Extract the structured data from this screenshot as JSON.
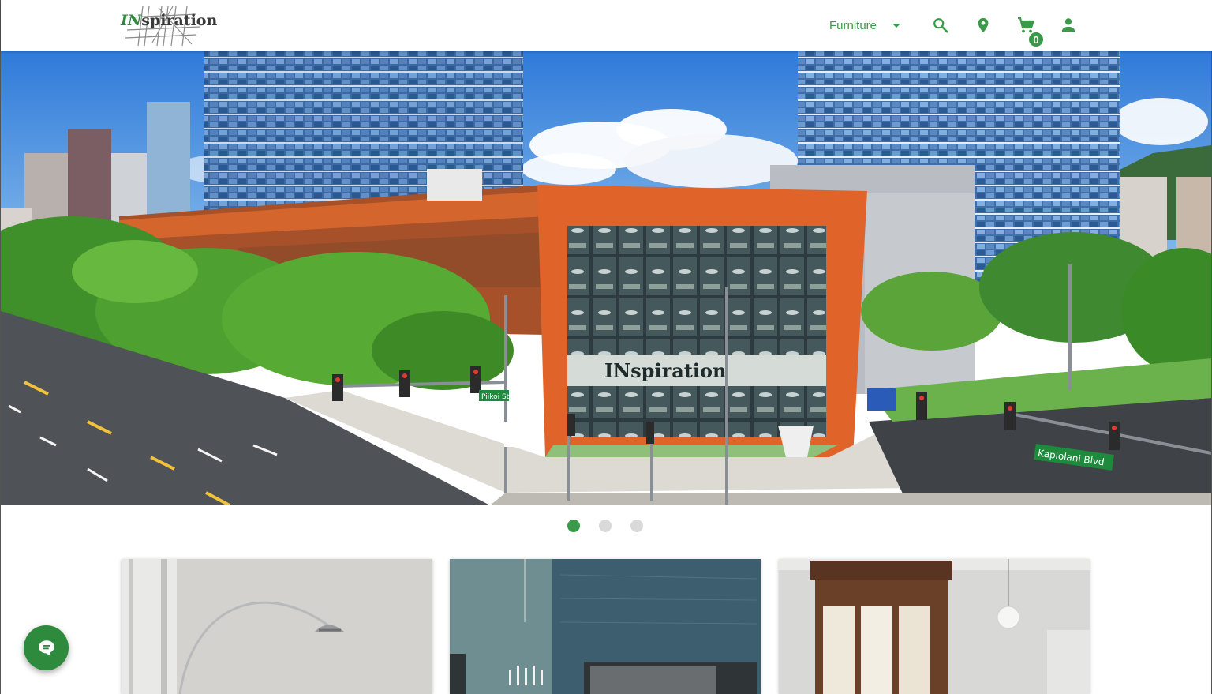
{
  "header": {
    "logo_alt": "INspiration",
    "category_select": {
      "selected": "Furniture"
    },
    "icons": [
      "search-icon",
      "location-icon",
      "cart-icon",
      "account-icon"
    ],
    "cart_count": "0"
  },
  "hero": {
    "slides_count": 3,
    "active_slide": 1,
    "image": "INspiration furniture store building exterior on Kapiolani Blvd",
    "street_signs": {
      "cross_street": "Piikoi St",
      "main_street": "Kapiolani Blvd"
    },
    "storefront_text": "INspiration"
  },
  "cards": [
    {
      "image": "Arc floor lamp in grey room"
    },
    {
      "image": "Modern bedroom with chandelier"
    },
    {
      "image": "Classic room with wooden bay window and pendant light"
    }
  ],
  "chat": {
    "icon": "chat-icon"
  },
  "colors": {
    "brand_green": "#3a9a4a",
    "chat_green": "#2e8b3e",
    "dot_inactive": "#d9d9d9"
  }
}
